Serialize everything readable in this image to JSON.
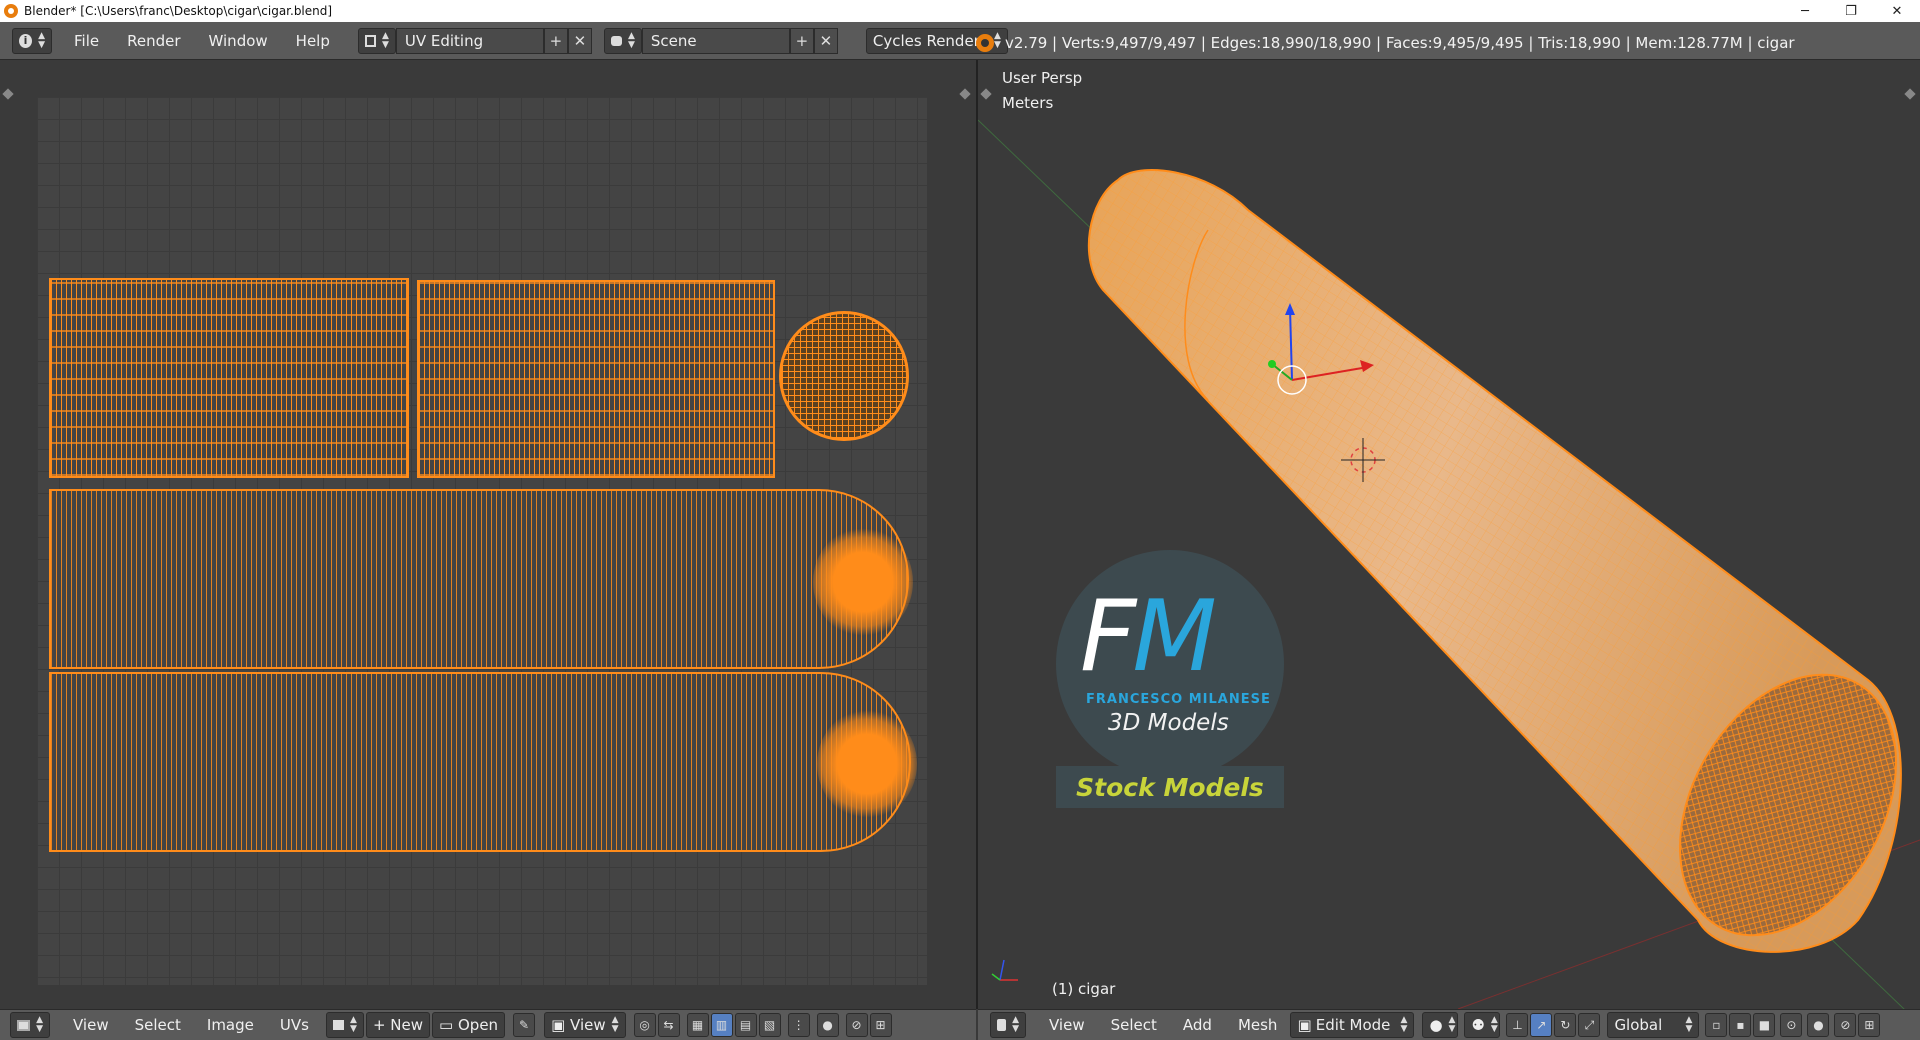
{
  "window": {
    "title": "Blender* [C:\\Users\\franc\\Desktop\\cigar\\cigar.blend]",
    "minimize": "─",
    "restore": "❐",
    "close": "✕"
  },
  "topbar": {
    "info_icon": "i",
    "menus": [
      "File",
      "Render",
      "Window",
      "Help"
    ],
    "layout": "UV Editing",
    "scene": "Scene",
    "engine": "Cycles Render",
    "stats": "v2.79 | Verts:9,497/9,497 | Edges:18,990/18,990 | Faces:9,495/9,495 | Tris:18,990 | Mem:128.77M | cigar"
  },
  "viewport": {
    "view_name": "User Persp",
    "units": "Meters",
    "object_label": "(1) cigar"
  },
  "logo": {
    "letters_f": "F",
    "letters_m": "M",
    "name": "FRANCESCO MILANESE",
    "subtitle": "3D Models",
    "banner": "Stock Models"
  },
  "uv_bar": {
    "menus": [
      "View",
      "Select",
      "Image",
      "UVs"
    ],
    "new": "New",
    "open": "Open",
    "view": "View"
  },
  "view3d_bar": {
    "menus": [
      "View",
      "Select",
      "Add",
      "Mesh"
    ],
    "mode": "Edit Mode",
    "orientation": "Global"
  },
  "colors": {
    "accent_orange": "#ff8c1a",
    "mesh_fill": "#e0a35e",
    "panel_bg": "#393939",
    "header_bg": "#5a5a5a",
    "logo_blue": "#2aa6dc",
    "logo_yellow": "#c8d43a"
  },
  "icons": [
    "info-icon",
    "blender-icon",
    "screen-layout-icon",
    "scene-icon",
    "add-icon",
    "close-icon",
    "editor-type-icon",
    "image-icon",
    "pin-icon",
    "render-icon",
    "cursor-icon",
    "axis-icon",
    "transform-manipulator-icon",
    "3d-cursor-icon"
  ]
}
